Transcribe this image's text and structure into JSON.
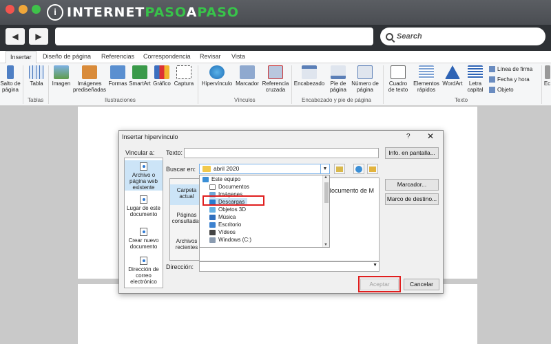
{
  "brand": {
    "logo_mark": "i",
    "part1": "INTERNET",
    "part2": "PASO",
    "part3": "A",
    "part4": "PASO"
  },
  "browser": {
    "search_label": "Search"
  },
  "ribbon": {
    "tabs": [
      "Insertar",
      "Diseño de página",
      "Referencias",
      "Correspondencia",
      "Revisar",
      "Vista"
    ],
    "groups": {
      "tablas": "Tablas",
      "ilustraciones": "Ilustraciones",
      "vinculos": "Vínculos",
      "encabezado": "Encabezado y pie de página",
      "texto": "Texto"
    },
    "buttons": {
      "salto": "Salto de\npágina",
      "tabla": "Tabla",
      "imagen": "Imagen",
      "imagenes_pred": "Imágenes\nprediseñadas",
      "formas": "Formas",
      "smartart": "SmartArt",
      "grafico": "Gráfico",
      "captura": "Captura",
      "hipervinculo": "Hipervínculo",
      "marcador": "Marcador",
      "referencia": "Referencia\ncruzada",
      "encabezado": "Encabezado",
      "pie": "Pie de\npágina",
      "numero": "Número de\npágina",
      "cuadro": "Cuadro\nde texto",
      "elementos": "Elementos\nrápidos",
      "wordart": "WordArt",
      "letra": "Letra\ncapital",
      "linea_firma": "Línea de firma",
      "fecha_hora": "Fecha y hora",
      "objeto": "Objeto",
      "ec": "Ec"
    }
  },
  "dialog": {
    "title": "Insertar hipervínculo",
    "help": "?",
    "close": "✕",
    "vincular_label": "Vincular a:",
    "link_options": [
      "Archivo o página web existente",
      "Lugar de este documento",
      "Crear nuevo documento",
      "Dirección de correo electrónico"
    ],
    "texto_label": "Texto:",
    "texto_value": "",
    "info_button": "Info. en pantalla...",
    "buscar_label": "Buscar en:",
    "buscar_value": "abril 2020",
    "folder_options": [
      "Carpeta actual",
      "Páginas consultadas",
      "Archivos recientes"
    ],
    "dropdown_items": [
      "Este equipo",
      "Documentos",
      "Imágenes",
      "Descargas",
      "Objetos 3D",
      "Música",
      "Escritorio",
      "Vídeos",
      "Windows (C:)"
    ],
    "selected_item": "Descargas",
    "peek_text": "documento de M",
    "marcador_button": "Marcador...",
    "marco_button": "Marco de destino...",
    "direccion_label": "Dirección:",
    "direccion_value": "",
    "accept_button": "Aceptar",
    "cancel_button": "Cancelar"
  },
  "colors": {
    "highlight": "#e01e1e",
    "selection": "#cce4f7",
    "brand_green": "#38c34a"
  }
}
